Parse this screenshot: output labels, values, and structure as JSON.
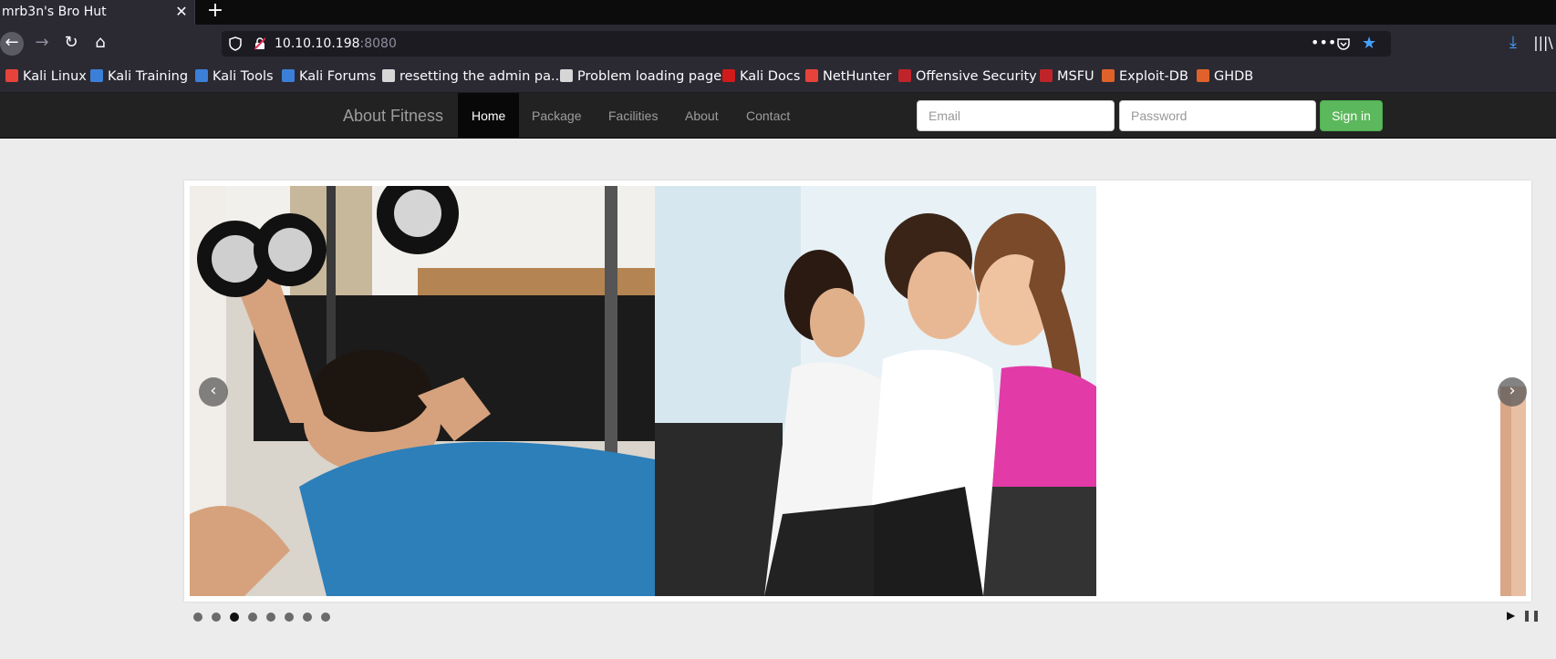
{
  "browser": {
    "tab_title": "mrb3n's Bro Hut",
    "tab_close": "✕",
    "new_tab": "+",
    "url_host": "10.10.10.198",
    "url_port": ":8080",
    "url_more": "•••"
  },
  "bookmarks": [
    {
      "label": "Kali Linux",
      "icon": "kali-dragon-icon",
      "color": "#e8433a"
    },
    {
      "label": "Kali Training",
      "icon": "kali-training-icon",
      "color": "#3b7fd9"
    },
    {
      "label": "Kali Tools",
      "icon": "kali-tools-icon",
      "color": "#3b7fd9"
    },
    {
      "label": "Kali Forums",
      "icon": "kali-forums-icon",
      "color": "#3b7fd9"
    },
    {
      "label": "resetting the admin pa...",
      "icon": "site-icon",
      "color": "#d6d6d6"
    },
    {
      "label": "Problem loading page",
      "icon": "globe-icon",
      "color": "#d6d6d6"
    },
    {
      "label": "Kali Docs",
      "icon": "kali-docs-icon",
      "color": "#d11a1a"
    },
    {
      "label": "NetHunter",
      "icon": "nethunter-icon",
      "color": "#e8433a"
    },
    {
      "label": "Offensive Security",
      "icon": "offsec-icon",
      "color": "#c0242a"
    },
    {
      "label": "MSFU",
      "icon": "msfu-icon",
      "color": "#c0242a"
    },
    {
      "label": "Exploit-DB",
      "icon": "exploitdb-icon",
      "color": "#e0622a"
    },
    {
      "label": "GHDB",
      "icon": "ghdb-icon",
      "color": "#e0622a"
    }
  ],
  "site": {
    "brand": "About Fitness",
    "menu": [
      "Home",
      "Package",
      "Facilities",
      "About",
      "Contact"
    ],
    "active_menu": "Home",
    "email_placeholder": "Email",
    "password_placeholder": "Password",
    "signin_label": "Sign in",
    "signin_color": "#5cb85c",
    "carousel": {
      "prev": "‹",
      "next": "›",
      "dot_count": 8,
      "active_dot": 3,
      "play": "▶",
      "pause": "❚❚"
    }
  }
}
